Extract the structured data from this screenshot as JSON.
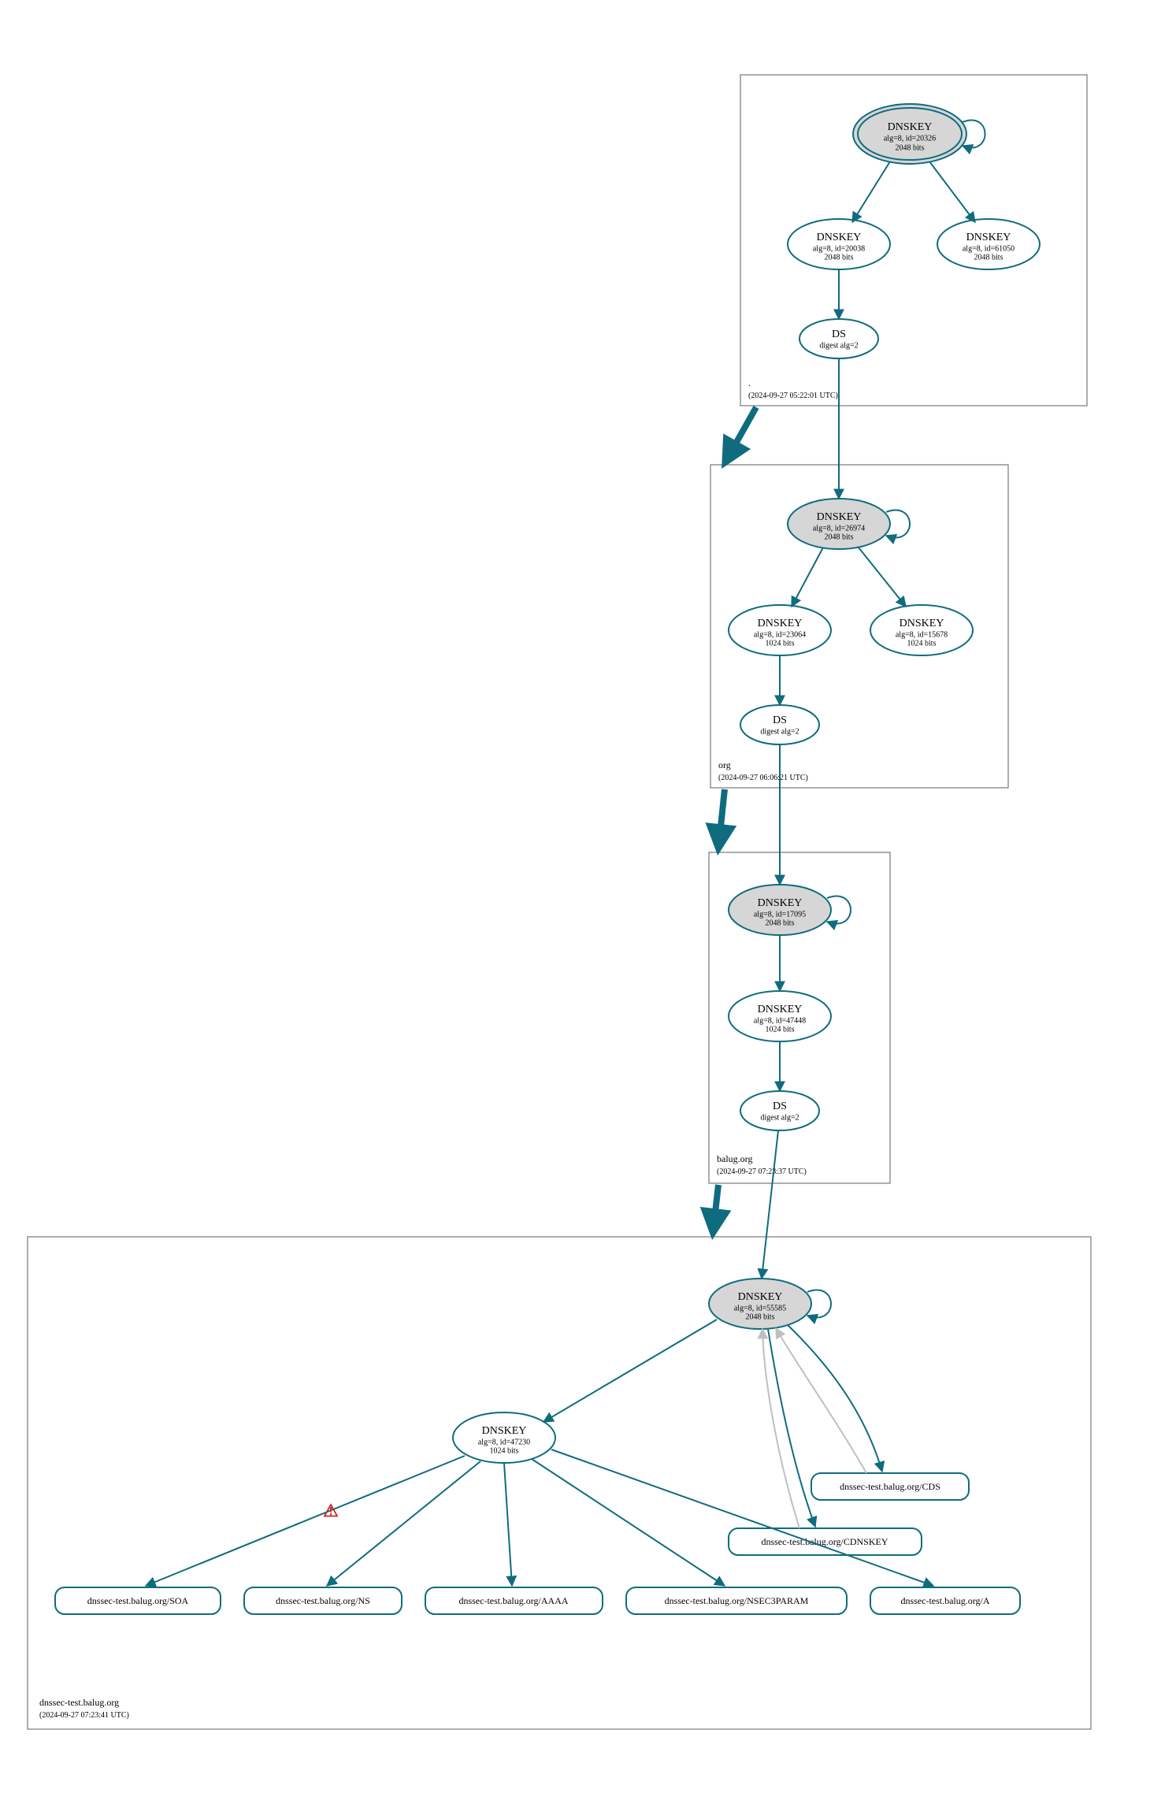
{
  "colors": {
    "stroke": "#0f6c7e",
    "fillKey": "#d6d6d6",
    "white": "#ffffff",
    "lightEdge": "#bfbfbf",
    "warn": "#c62828"
  },
  "zones": {
    "root": {
      "name": ".",
      "time": "(2024-09-27 05:22:01 UTC)"
    },
    "org": {
      "name": "org",
      "time": "(2024-09-27 06:06:21 UTC)"
    },
    "balug": {
      "name": "balug.org",
      "time": "(2024-09-27 07:23:37 UTC)"
    },
    "test": {
      "name": "dnssec-test.balug.org",
      "time": "(2024-09-27 07:23:41 UTC)"
    }
  },
  "nodes": {
    "root_ksk": {
      "title": "DNSKEY",
      "sub1": "alg=8, id=20326",
      "sub2": "2048 bits"
    },
    "root_zsk1": {
      "title": "DNSKEY",
      "sub1": "alg=8, id=20038",
      "sub2": "2048 bits"
    },
    "root_zsk2": {
      "title": "DNSKEY",
      "sub1": "alg=8, id=61050",
      "sub2": "2048 bits"
    },
    "root_ds": {
      "title": "DS",
      "sub1": "digest alg=2"
    },
    "org_ksk": {
      "title": "DNSKEY",
      "sub1": "alg=8, id=26974",
      "sub2": "2048 bits"
    },
    "org_zsk1": {
      "title": "DNSKEY",
      "sub1": "alg=8, id=23064",
      "sub2": "1024 bits"
    },
    "org_zsk2": {
      "title": "DNSKEY",
      "sub1": "alg=8, id=15678",
      "sub2": "1024 bits"
    },
    "org_ds": {
      "title": "DS",
      "sub1": "digest alg=2"
    },
    "balug_ksk": {
      "title": "DNSKEY",
      "sub1": "alg=8, id=17095",
      "sub2": "2048 bits"
    },
    "balug_zsk": {
      "title": "DNSKEY",
      "sub1": "alg=8, id=47448",
      "sub2": "1024 bits"
    },
    "balug_ds": {
      "title": "DS",
      "sub1": "digest alg=2"
    },
    "test_ksk": {
      "title": "DNSKEY",
      "sub1": "alg=8, id=55585",
      "sub2": "2048 bits"
    },
    "test_zsk": {
      "title": "DNSKEY",
      "sub1": "alg=8, id=47230",
      "sub2": "1024 bits"
    }
  },
  "leaves": {
    "soa": "dnssec-test.balug.org/SOA",
    "ns": "dnssec-test.balug.org/NS",
    "aaaa": "dnssec-test.balug.org/AAAA",
    "nsec": "dnssec-test.balug.org/NSEC3PARAM",
    "a": "dnssec-test.balug.org/A",
    "cdnskey": "dnssec-test.balug.org/CDNSKEY",
    "cds": "dnssec-test.balug.org/CDS"
  },
  "warn_glyph": "⚠"
}
